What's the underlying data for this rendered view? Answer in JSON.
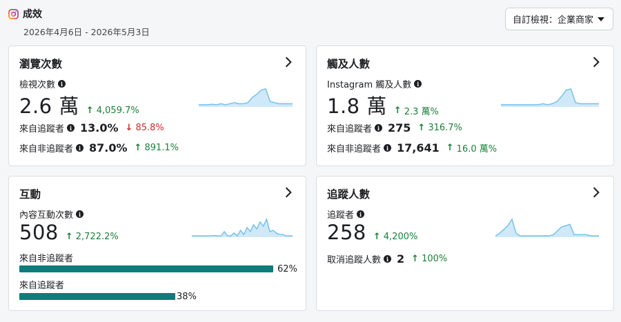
{
  "header": {
    "title": "成效",
    "date_range": "2026年4月6日 - 2026年5月3日"
  },
  "dropdown": {
    "label": "自訂檢視：企業商家"
  },
  "colors": {
    "positive": "#1a7f37",
    "negative": "#c4302b",
    "bar": "#0e7c7b",
    "spark_line": "#7cc4ea",
    "spark_fill": "#cfe9f8"
  },
  "cards": {
    "views": {
      "title": "瀏覽次數",
      "metric_label": "檢視次數",
      "value": "2.6 萬",
      "delta": "4,059.7%",
      "followers_label": "來自追蹤者",
      "followers_value": "13.0%",
      "followers_delta": "85.8%",
      "non_followers_label": "來自非追蹤者",
      "non_followers_value": "87.0%",
      "non_followers_delta": "891.1%",
      "spark": [
        2,
        2,
        2,
        2.5,
        2,
        3,
        2,
        3,
        4,
        3,
        3,
        4,
        9,
        12,
        16,
        17,
        5,
        4,
        3,
        3,
        3,
        3
      ]
    },
    "reach": {
      "title": "觸及人數",
      "metric_label": "Instagram 觸及人數",
      "value": "1.8 萬",
      "delta": "2.3 萬%",
      "followers_label": "來自追蹤者",
      "followers_value": "275",
      "followers_delta": "316.7%",
      "non_followers_label": "來自非追蹤者",
      "non_followers_value": "17,641",
      "non_followers_delta": "16.0 萬%",
      "spark": [
        2,
        2,
        2,
        2,
        2,
        2,
        2,
        2,
        2,
        3,
        2,
        3,
        5,
        10,
        16,
        17,
        4,
        3,
        3,
        3,
        3,
        3
      ]
    },
    "engagement": {
      "title": "互動",
      "metric_label": "內容互動次數",
      "value": "508",
      "delta": "2,722.2%",
      "bars": [
        {
          "label": "來自非追蹤者",
          "pct_label": "62%",
          "fraction": 0.62
        },
        {
          "label": "來自追蹤者",
          "pct_label": "38%",
          "fraction": 0.38
        }
      ],
      "spark": [
        1,
        1,
        1,
        1,
        1,
        1,
        1,
        1.2,
        1,
        1,
        4,
        1,
        1,
        3,
        1,
        5,
        2,
        7,
        4,
        9,
        6,
        11,
        8,
        13,
        4,
        5,
        3,
        2,
        2,
        1,
        1,
        1
      ]
    },
    "followers": {
      "title": "追蹤人數",
      "metric_label": "追蹤者",
      "value": "258",
      "delta": "4,200%",
      "unfollow_label": "取消追蹤人數",
      "unfollow_value": "2",
      "unfollow_delta": "100%",
      "spark": [
        1,
        3,
        6,
        9,
        14,
        3,
        1,
        1,
        1,
        1,
        1,
        1,
        1.2,
        1,
        2,
        5,
        8,
        9,
        10,
        2,
        2,
        2,
        2,
        1,
        1,
        1
      ]
    }
  }
}
